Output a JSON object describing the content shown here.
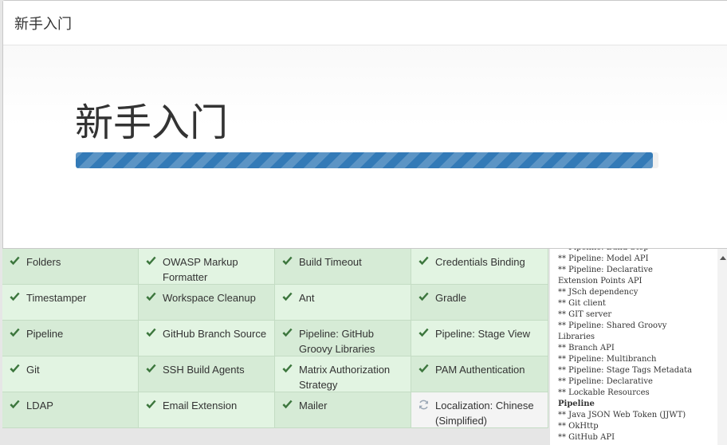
{
  "dialog": {
    "title": "新手入门",
    "heading": "新手入门",
    "progress": 0.99,
    "progress_color": "#337ab7"
  },
  "plugins": [
    {
      "name": "Folders",
      "status": "installed"
    },
    {
      "name": "OWASP Markup Formatter",
      "status": "installed"
    },
    {
      "name": "Build Timeout",
      "status": "installed"
    },
    {
      "name": "Credentials Binding",
      "status": "installed"
    },
    {
      "name": "Timestamper",
      "status": "installed"
    },
    {
      "name": "Workspace Cleanup",
      "status": "installed"
    },
    {
      "name": "Ant",
      "status": "installed"
    },
    {
      "name": "Gradle",
      "status": "installed"
    },
    {
      "name": "Pipeline",
      "status": "installed"
    },
    {
      "name": "GitHub Branch Source",
      "status": "installed"
    },
    {
      "name": "Pipeline: GitHub Groovy Libraries",
      "status": "installed"
    },
    {
      "name": "Pipeline: Stage View",
      "status": "installed"
    },
    {
      "name": "Git",
      "status": "installed"
    },
    {
      "name": "SSH Build Agents",
      "status": "installed"
    },
    {
      "name": "Matrix Authorization Strategy",
      "status": "installed"
    },
    {
      "name": "PAM Authentication",
      "status": "installed"
    },
    {
      "name": "LDAP",
      "status": "installed"
    },
    {
      "name": "Email Extension",
      "status": "installed"
    },
    {
      "name": "Mailer",
      "status": "installed"
    },
    {
      "name": "Localization: Chinese (Simplified)",
      "status": "installing"
    }
  ],
  "colors": {
    "installed_dark": "#d6ebd6",
    "installed_light": "#e2f4e2",
    "check": "#3c763d",
    "pending_icon": "#9aa7b5"
  },
  "log": [
    {
      "text": "** Pipeline: Build Step",
      "bold": false
    },
    {
      "text": "** Pipeline: Model API",
      "bold": false
    },
    {
      "text": "** Pipeline: Declarative",
      "bold": false
    },
    {
      "text": "Extension Points API",
      "bold": false
    },
    {
      "text": "** JSch dependency",
      "bold": false
    },
    {
      "text": "** Git client",
      "bold": false
    },
    {
      "text": "** GIT server",
      "bold": false
    },
    {
      "text": "** Pipeline: Shared Groovy",
      "bold": false
    },
    {
      "text": "Libraries",
      "bold": false
    },
    {
      "text": "** Branch API",
      "bold": false
    },
    {
      "text": "** Pipeline: Multibranch",
      "bold": false
    },
    {
      "text": "** Pipeline: Stage Tags Metadata",
      "bold": false
    },
    {
      "text": "** Pipeline: Declarative",
      "bold": false
    },
    {
      "text": "** Lockable Resources",
      "bold": false
    },
    {
      "text": "Pipeline",
      "bold": true
    },
    {
      "text": "** Java JSON Web Token (JJWT)",
      "bold": false
    },
    {
      "text": "** OkHttp",
      "bold": false
    },
    {
      "text": "** GitHub API",
      "bold": false
    }
  ]
}
